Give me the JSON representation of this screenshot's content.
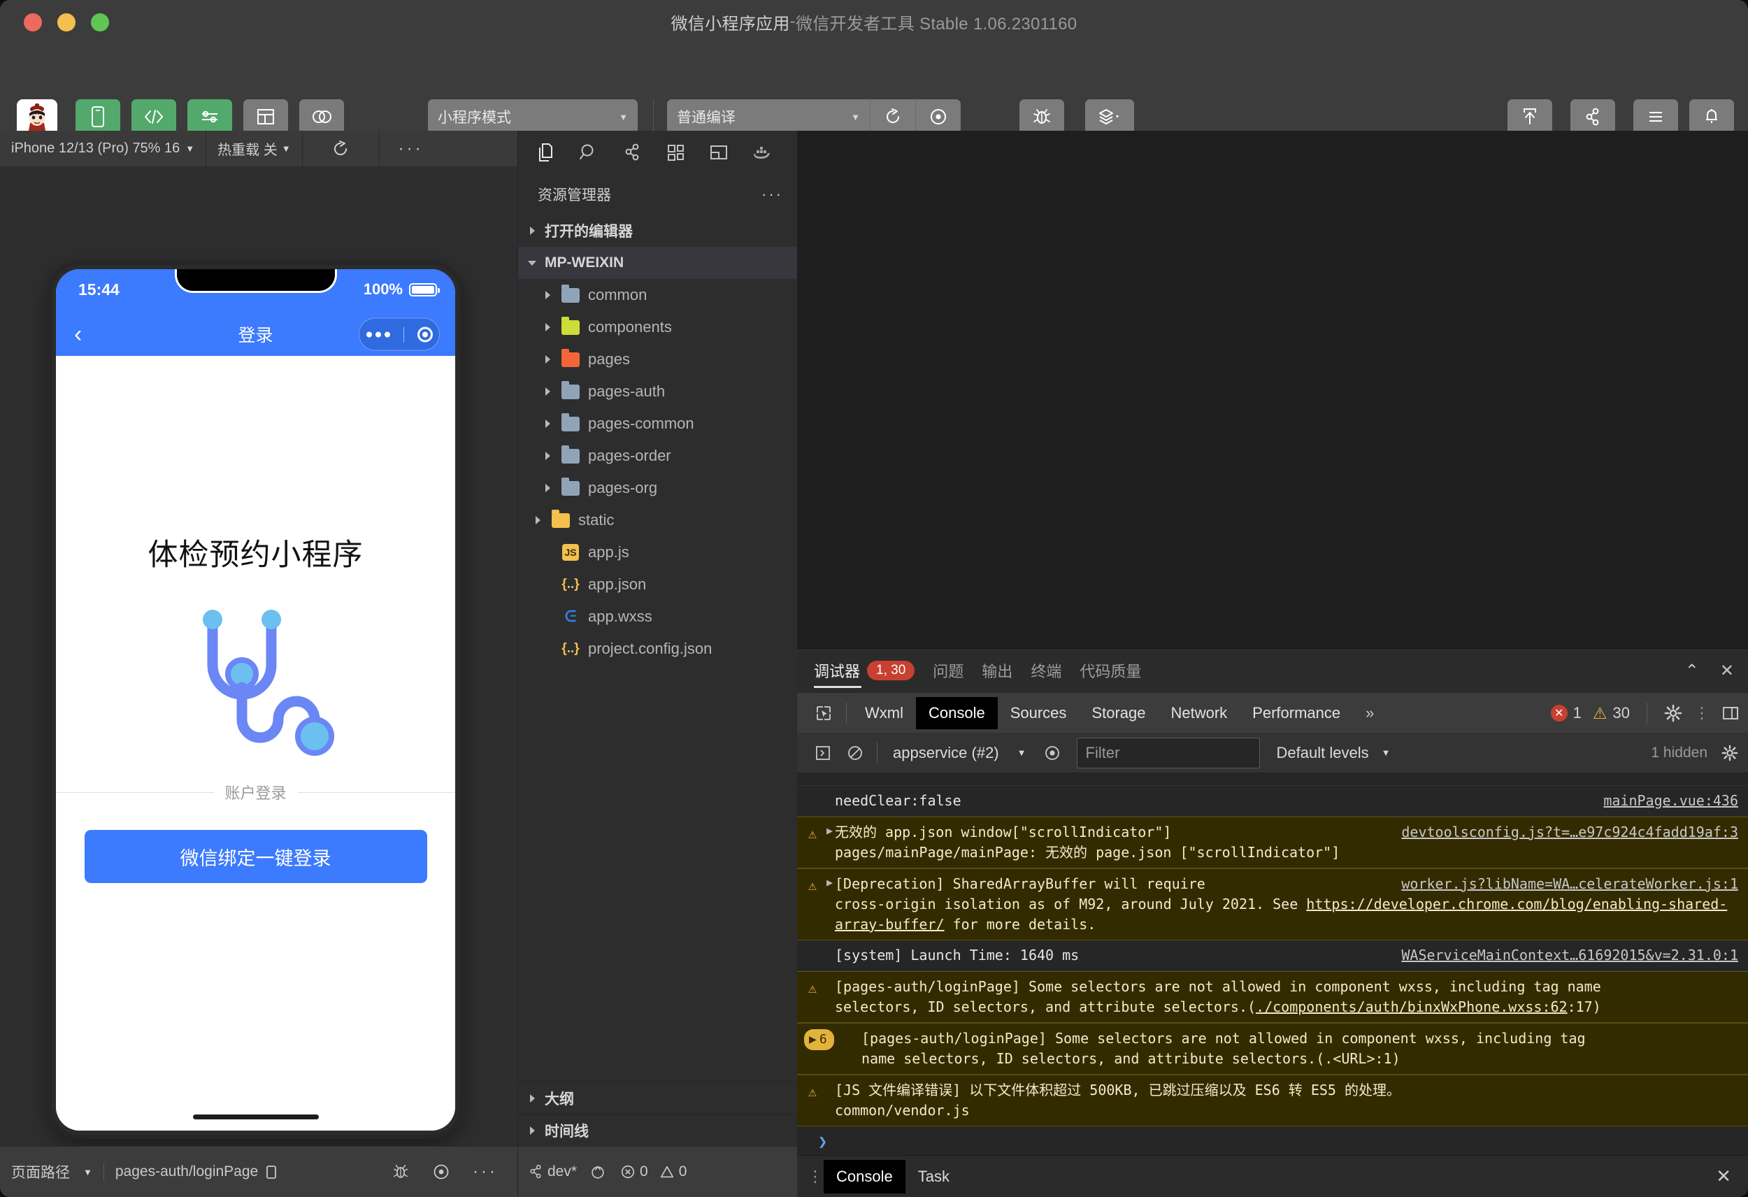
{
  "window": {
    "title_main": "微信小程序应用",
    "title_sep": " - ",
    "title_sub": "微信开发者工具 Stable 1.06.2301160"
  },
  "toolbar": {
    "left_items": [
      {
        "label": "模拟器",
        "icon": "phone-icon",
        "style": "green"
      },
      {
        "label": "编辑器",
        "icon": "code-icon",
        "style": "green"
      },
      {
        "label": "调试器",
        "icon": "sliders-icon",
        "style": "green"
      },
      {
        "label": "可视化",
        "icon": "layout-icon",
        "style": "grey"
      },
      {
        "label": "云开发",
        "icon": "cloud-icon",
        "style": "grey"
      }
    ],
    "mode_select": "小程序模式",
    "compile_select": "普通编译",
    "compile_label": "编译",
    "preview_label": "预览",
    "realdevice_label": "真机调试",
    "clearcache_label": "清缓存",
    "right_items": [
      {
        "label": "上传",
        "icon": "upload-icon"
      },
      {
        "label": "版本管理",
        "icon": "branch-icon"
      },
      {
        "label": "详情",
        "icon": "menu-icon"
      },
      {
        "label": "消息",
        "icon": "bell-icon"
      }
    ]
  },
  "simulator": {
    "device": "iPhone 12/13 (Pro) 75% 16",
    "hotreload": "热重载 关",
    "refresh_icon": "refresh-icon",
    "more_icon": "more-icon",
    "phone": {
      "time": "15:44",
      "battery_text": "100%",
      "nav_title": "登录",
      "back_icon": "chevron-left-icon",
      "capsule_more_icon": "capsule-more-icon",
      "capsule_target_icon": "capsule-target-icon",
      "app_title": "体检预约小程序",
      "logo_icon": "stethoscope-icon",
      "account_divider_label": "账户登录",
      "login_button": "微信绑定一键登录"
    }
  },
  "left_status": {
    "path_label": "页面路径",
    "page_path": "pages-auth/loginPage",
    "copy_icon": "copy-icon",
    "bug_icon": "bug-icon",
    "eye_icon": "eye-icon",
    "more_icon": "more-icon"
  },
  "explorer": {
    "activity_icons": [
      "files-icon",
      "search-icon",
      "source-control-icon",
      "extensions-icon",
      "split-icon",
      "docker-icon"
    ],
    "header": "资源管理器",
    "header_more_icon": "more-icon",
    "sections": [
      {
        "label": "打开的编辑器",
        "open": false
      },
      {
        "label": "MP-WEIXIN",
        "open": true
      }
    ],
    "tree": [
      {
        "name": "common",
        "type": "folder",
        "color": "f-blue"
      },
      {
        "name": "components",
        "type": "folder",
        "color": "f-lime"
      },
      {
        "name": "pages",
        "type": "folder",
        "color": "f-orange"
      },
      {
        "name": "pages-auth",
        "type": "folder",
        "color": "f-blue"
      },
      {
        "name": "pages-common",
        "type": "folder",
        "color": "f-blue"
      },
      {
        "name": "pages-order",
        "type": "folder",
        "color": "f-blue"
      },
      {
        "name": "pages-org",
        "type": "folder",
        "color": "f-blue"
      },
      {
        "name": "static",
        "type": "folder",
        "color": "f-yellow"
      },
      {
        "name": "app.js",
        "type": "js"
      },
      {
        "name": "app.json",
        "type": "json"
      },
      {
        "name": "app.wxss",
        "type": "wxss"
      },
      {
        "name": "project.config.json",
        "type": "json"
      }
    ],
    "bottom_sections": [
      {
        "label": "大纲"
      },
      {
        "label": "时间线"
      }
    ],
    "status": {
      "branch": "dev*",
      "branch_icon": "branch-icon",
      "sync_icon": "sync-icon",
      "errors": "0",
      "warnings": "0"
    }
  },
  "debugger": {
    "panel_tabs": [
      {
        "label": "调试器",
        "badge": "1, 30",
        "active": true
      },
      {
        "label": "问题",
        "active": false
      },
      {
        "label": "输出",
        "active": false
      },
      {
        "label": "终端",
        "active": false
      },
      {
        "label": "代码质量",
        "active": false
      }
    ],
    "collapse_icon": "chevron-up-icon",
    "close_icon": "close-icon",
    "devtools_tabs": [
      {
        "label": "Wxml",
        "active": false
      },
      {
        "label": "Console",
        "active": true
      },
      {
        "label": "Sources",
        "active": false
      },
      {
        "label": "Storage",
        "active": false
      },
      {
        "label": "Network",
        "active": false
      },
      {
        "label": "Performance",
        "active": false
      }
    ],
    "overflow_icon": "chevrons-right-icon",
    "inspect_icon": "inspect-icon",
    "error_count": "1",
    "warning_count": "30",
    "settings_icon": "gear-icon",
    "kebab_icon": "kebab-icon",
    "dock_icon": "dock-icon",
    "console": {
      "sidebar_icon": "panel-icon",
      "clear_icon": "clear-icon",
      "context": "appservice (#2)",
      "eye_icon": "eye-icon",
      "filter_placeholder": "Filter",
      "levels": "Default levels",
      "hidden_text": "1 hidden",
      "settings_icon": "gear-icon",
      "messages": [
        {
          "kind": "plain",
          "clipped": true,
          "text": "",
          "source": ""
        },
        {
          "kind": "plain",
          "text": "needClear:false",
          "source": "mainPage.vue:436"
        },
        {
          "kind": "warn",
          "expandable": true,
          "text": "无效的 app.json window[\"scrollIndicator\"]",
          "text2": "pages/mainPage/mainPage: 无效的 page.json [\"scrollIndicator\"]",
          "source": "devtoolsconfig.js?t=…e97c924c4fadd19af:3"
        },
        {
          "kind": "warn",
          "expandable": true,
          "text": "[Deprecation] SharedArrayBuffer will require",
          "text2": "cross-origin isolation as of M92, around July 2021. See ",
          "link": "https://developer.chrome.com/blog/enabling-shared-array-buffer/",
          "text3": " for more details.",
          "source": "worker.js?libName=WA…celerateWorker.js:1"
        },
        {
          "kind": "plain",
          "text": "[system] Launch Time: 1640 ms",
          "source": "WAServiceMainContext…61692015&v=2.31.0:1"
        },
        {
          "kind": "warn",
          "text": "[pages-auth/loginPage] Some selectors are not allowed in component wxss, including tag name",
          "text2": "selectors, ID selectors, and attribute selectors.(",
          "link": "./components/auth/binxWxPhone.wxss:62",
          "text3": ":17)"
        },
        {
          "kind": "group",
          "count": "6",
          "text": "[pages-auth/loginPage] Some selectors are not allowed in component wxss, including tag",
          "text2": "name selectors, ID selectors, and attribute selectors.(.<URL>:1)"
        },
        {
          "kind": "warn",
          "text": "[JS 文件编译错误] 以下文件体积超过 500KB, 已跳过压缩以及 ES6 转 ES5 的处理。",
          "text2": "common/vendor.js"
        }
      ],
      "prompt": "❯",
      "footer_tabs": [
        {
          "label": "Console",
          "active": true
        },
        {
          "label": "Task",
          "active": false
        }
      ],
      "footer_kebab_icon": "kebab-icon",
      "footer_close_icon": "close-icon"
    }
  },
  "colors": {
    "accent_green": "#53a96b",
    "phone_blue": "#3c7afe",
    "error_red": "#c84031",
    "warn_yellow": "#e2b33c"
  }
}
